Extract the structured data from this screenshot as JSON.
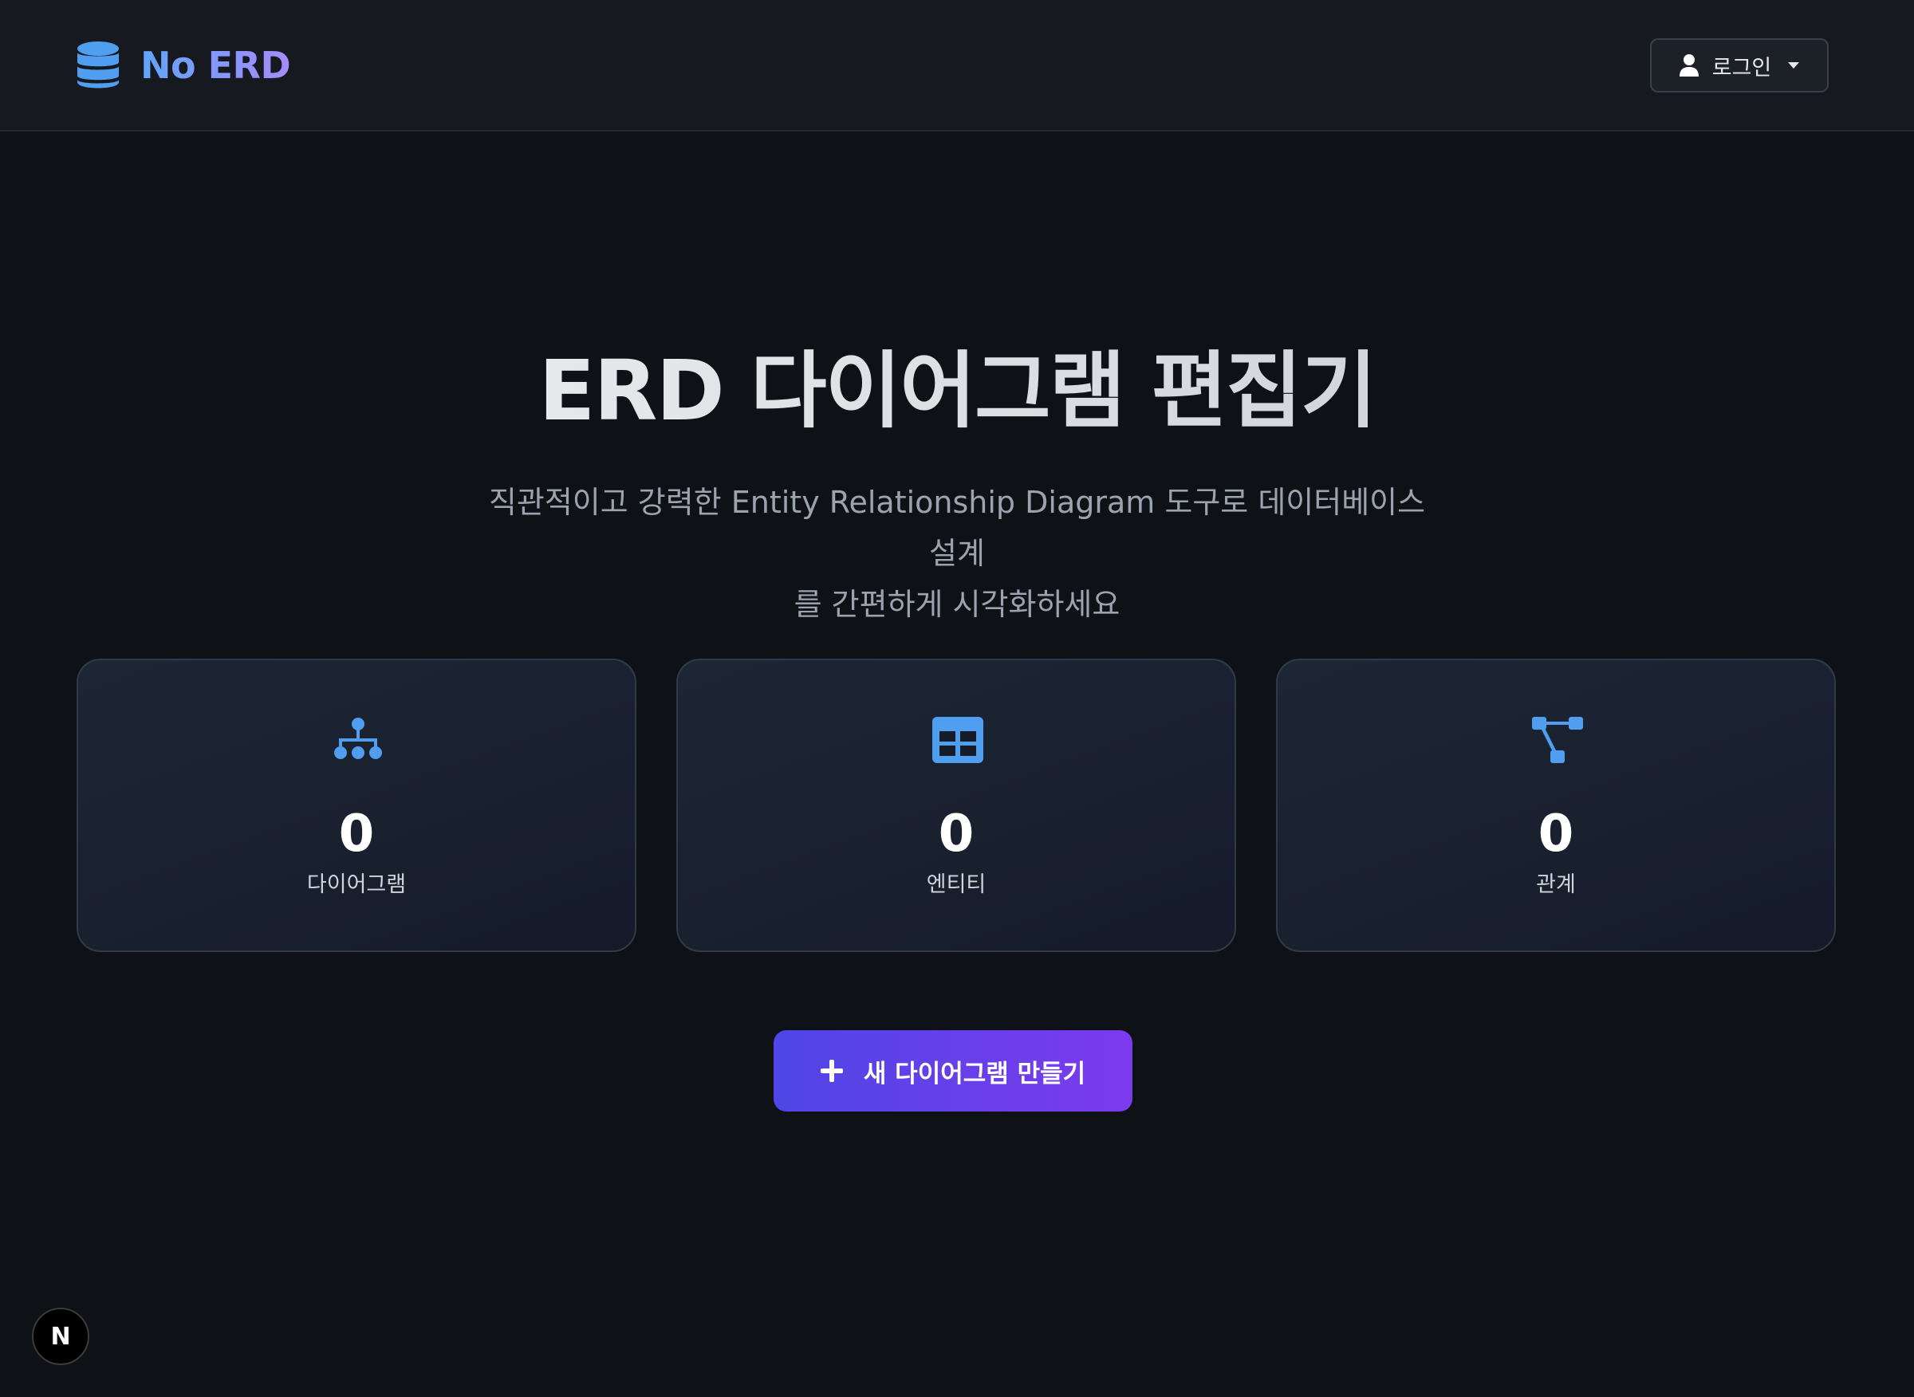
{
  "header": {
    "logo_icon": "database-icon",
    "brand": "No ERD",
    "login_label": "로그인",
    "login_icon": "user-icon",
    "dropdown_icon": "caret-down-icon"
  },
  "hero": {
    "title": "ERD 다이어그램 편집기",
    "subtitle_line1": "직관적이고 강력한 Entity Relationship Diagram 도구로 데이터베이스 설계",
    "subtitle_line2": "를 간편하게 시각화하세요"
  },
  "stats": [
    {
      "icon": "sitemap-icon",
      "value": "0",
      "label": "다이어그램"
    },
    {
      "icon": "table-icon",
      "value": "0",
      "label": "엔티티"
    },
    {
      "icon": "relation-icon",
      "value": "0",
      "label": "관계"
    }
  ],
  "cta": {
    "icon": "plus-icon",
    "label": "새 다이어그램 만들기"
  },
  "dev_badge": {
    "icon": "nextjs-icon",
    "label": "N"
  },
  "colors": {
    "background": "#0e1217",
    "header": "#161a20",
    "accent_blue": "#60a5fa",
    "accent_purple": "#7c3aed",
    "icon_blue": "#4f9ef0"
  }
}
